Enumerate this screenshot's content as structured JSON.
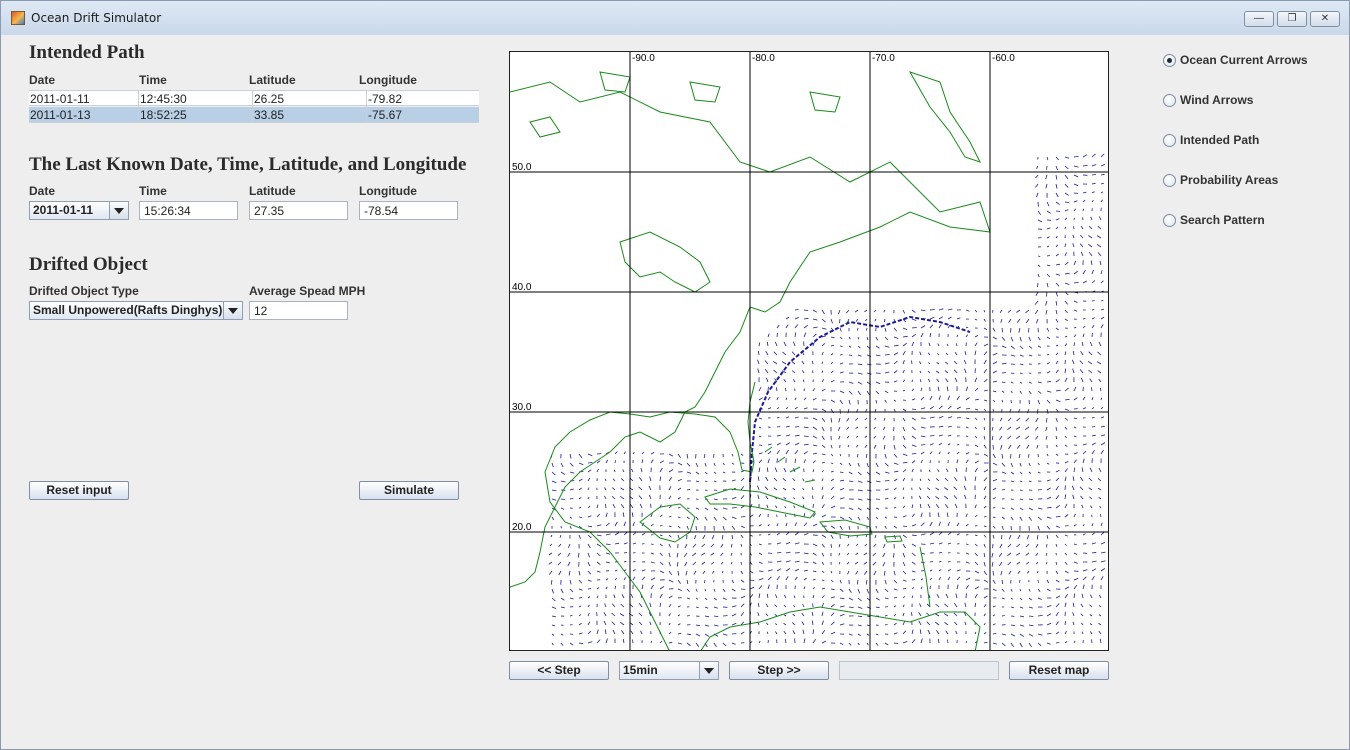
{
  "window": {
    "title": "Ocean Drift Simulator",
    "controls": [
      "minimize",
      "maximize",
      "close"
    ]
  },
  "intended_path": {
    "heading": "Intended Path",
    "columns": [
      "Date",
      "Time",
      "Latitude",
      "Longitude"
    ],
    "rows": [
      {
        "date": "2011-01-11",
        "time": "12:45:30",
        "latitude": "26.25",
        "longitude": "-79.82",
        "selected": false
      },
      {
        "date": "2011-01-13",
        "time": "18:52:25",
        "latitude": "33.85",
        "longitude": "-75.67",
        "selected": true
      }
    ]
  },
  "last_known": {
    "heading": "The Last Known Date, Time, Latitude, and Longitude",
    "labels": {
      "date": "Date",
      "time": "Time",
      "latitude": "Latitude",
      "longitude": "Longitude"
    },
    "date": "2011-01-11",
    "time": "15:26:34",
    "latitude": "27.35",
    "longitude": "-78.54"
  },
  "drifted_object": {
    "heading": "Drifted Object",
    "type_label": "Drifted Object Type",
    "type_value": "Small Unpowered(Rafts Dinghys)",
    "speed_label": "Average Spead MPH",
    "speed_value": "12"
  },
  "buttons": {
    "reset_input": "Reset input",
    "simulate": "Simulate"
  },
  "layers": {
    "options": [
      {
        "label": "Ocean Current Arrows",
        "checked": true
      },
      {
        "label": "Wind Arrows",
        "checked": false
      },
      {
        "label": "Intended Path",
        "checked": false
      },
      {
        "label": "Probability Areas",
        "checked": false
      },
      {
        "label": "Search Pattern",
        "checked": false
      }
    ]
  },
  "map": {
    "lon_labels": [
      "-90.0",
      "-80.0",
      "-70.0",
      "-60.0"
    ],
    "lat_labels": [
      "50.0",
      "40.0",
      "30.0",
      "20.0"
    ],
    "colors": {
      "land_outline": "#1a8a1a",
      "current_arrows": "#1a1a9a",
      "grid": "#000000"
    }
  },
  "map_controls": {
    "step_back": "<< Step",
    "interval": "15min",
    "step_forward": "Step >>",
    "reset_map": "Reset map"
  }
}
